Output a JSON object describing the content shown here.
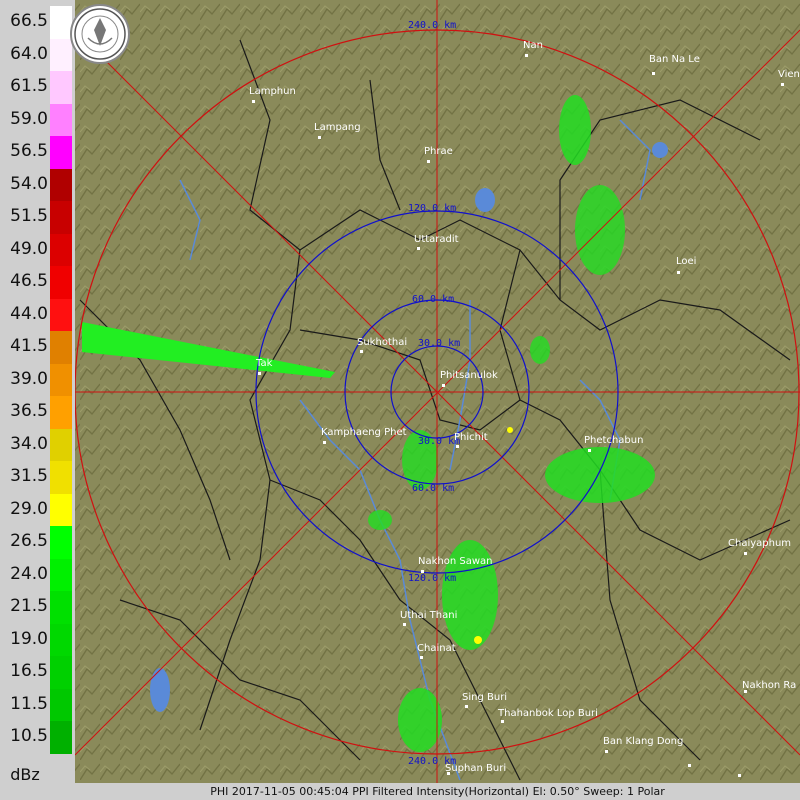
{
  "legend": {
    "unit": "dBz",
    "items": [
      {
        "label": "66.5",
        "color": "#ffffff"
      },
      {
        "label": "64.0",
        "color": "#fff0ff"
      },
      {
        "label": "61.5",
        "color": "#ffc8ff"
      },
      {
        "label": "59.0",
        "color": "#ff80ff"
      },
      {
        "label": "56.5",
        "color": "#ff00ff"
      },
      {
        "label": "54.0",
        "color": "#b00000"
      },
      {
        "label": "51.5",
        "color": "#c80000"
      },
      {
        "label": "49.0",
        "color": "#dc0000"
      },
      {
        "label": "46.5",
        "color": "#f00000"
      },
      {
        "label": "44.0",
        "color": "#ff1010"
      },
      {
        "label": "41.5",
        "color": "#e08000"
      },
      {
        "label": "39.0",
        "color": "#f09000"
      },
      {
        "label": "36.5",
        "color": "#ffa000"
      },
      {
        "label": "34.0",
        "color": "#e0d000"
      },
      {
        "label": "31.5",
        "color": "#f0e000"
      },
      {
        "label": "29.0",
        "color": "#ffff00"
      },
      {
        "label": "26.5",
        "color": "#00ff00"
      },
      {
        "label": "24.0",
        "color": "#00f000"
      },
      {
        "label": "21.5",
        "color": "#00e000"
      },
      {
        "label": "19.0",
        "color": "#00d800"
      },
      {
        "label": "16.5",
        "color": "#00d000"
      },
      {
        "label": "11.5",
        "color": "#00c800"
      },
      {
        "label": "10.5",
        "color": "#00b000"
      }
    ]
  },
  "range_rings": {
    "labels": [
      "240.0 km",
      "120.0 km",
      "60.0 km",
      "30.0 km",
      "30.0 km",
      "60.0 km",
      "120.0 km",
      "240.0 km"
    ]
  },
  "cities": [
    {
      "name": "Nan"
    },
    {
      "name": "Ban Na Le"
    },
    {
      "name": "Vien"
    },
    {
      "name": "Lamphun"
    },
    {
      "name": "Lampang"
    },
    {
      "name": "Phrae"
    },
    {
      "name": "Uttaradit"
    },
    {
      "name": "Loei"
    },
    {
      "name": "Sukhothai"
    },
    {
      "name": "Tak"
    },
    {
      "name": "Phitsanulok"
    },
    {
      "name": "Kamphaeng Phet"
    },
    {
      "name": "Phichit"
    },
    {
      "name": "Phetchabun"
    },
    {
      "name": "Chaiyaphum"
    },
    {
      "name": "Nakhon Sawan"
    },
    {
      "name": "Uthai Thani"
    },
    {
      "name": "Chainat"
    },
    {
      "name": "Nakhon Ra"
    },
    {
      "name": "Sing Buri"
    },
    {
      "name": "Thahanbok Lop Buri"
    },
    {
      "name": "Ban Klang Dong"
    },
    {
      "name": "Suphan Buri"
    }
  ],
  "status_text": "PHI 2017-11-05 00:45:04 PPI Filtered Intensity(Horizontal)  El: 0.50°  Sweep: 1 Polar",
  "colors": {
    "terrain": "#8a8a5a",
    "range_ring_outer": "#d01010",
    "range_ring_inner": "#1010cc",
    "crosshair": "#d01010"
  }
}
